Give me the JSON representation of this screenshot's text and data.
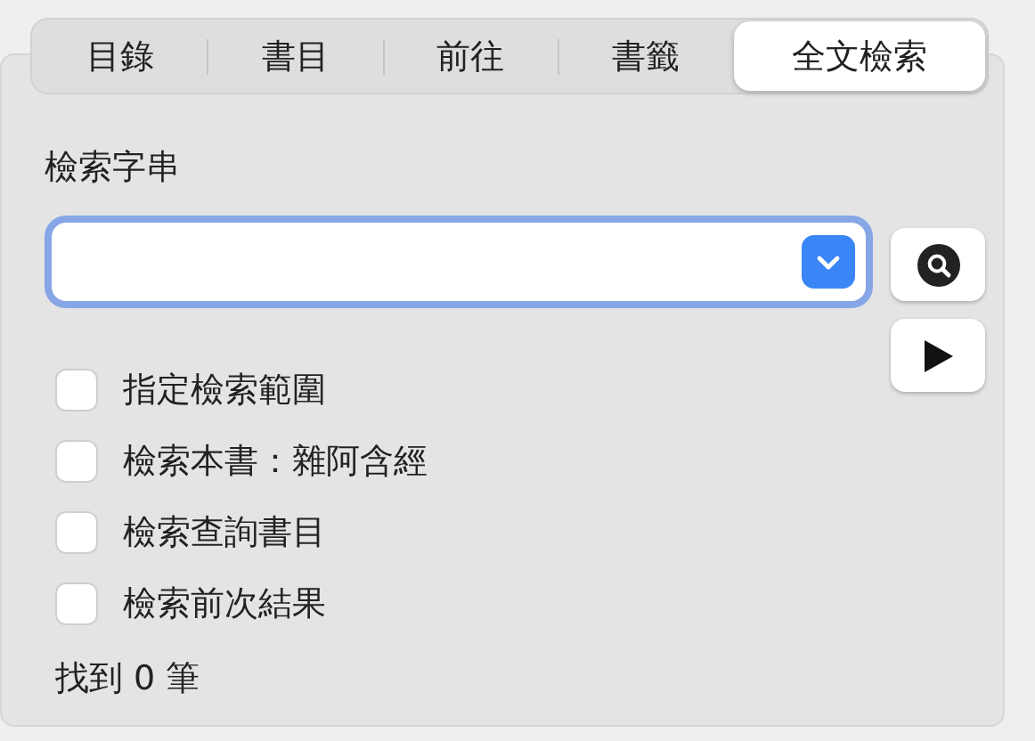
{
  "tabs": [
    {
      "label": "目錄",
      "selected": false
    },
    {
      "label": "書目",
      "selected": false
    },
    {
      "label": "前往",
      "selected": false
    },
    {
      "label": "書籤",
      "selected": false
    },
    {
      "label": "全文檢索",
      "selected": true
    }
  ],
  "search": {
    "label": "檢索字串",
    "focused": true
  },
  "options": [
    {
      "label": "指定檢索範圍",
      "checked": false
    },
    {
      "label": "檢索本書：雜阿含經",
      "checked": false
    },
    {
      "label": "檢索查詢書目",
      "checked": false
    },
    {
      "label": "檢索前次結果",
      "checked": false
    }
  ],
  "result": "找到 0 筆"
}
